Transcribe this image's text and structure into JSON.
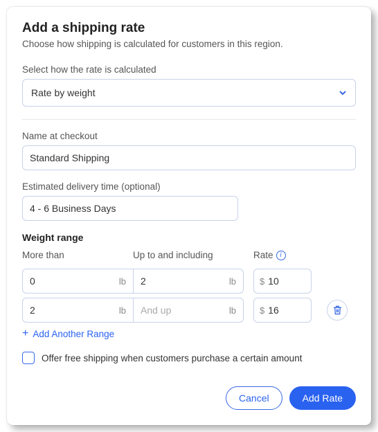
{
  "header": {
    "title": "Add a shipping rate",
    "subtitle": "Choose how shipping is calculated for customers in this region."
  },
  "calc": {
    "label": "Select how the rate is calculated",
    "value": "Rate by weight"
  },
  "nameField": {
    "label": "Name at checkout",
    "value": "Standard Shipping"
  },
  "etaField": {
    "label": "Estimated delivery time (optional)",
    "value": "4 - 6 Business Days"
  },
  "range": {
    "sectionTitle": "Weight range",
    "moreThanLabel": "More than",
    "upToLabel": "Up to and including",
    "rateLabel": "Rate",
    "unit": "lb",
    "currency": "$",
    "andUpPlaceholder": "And up",
    "rows": [
      {
        "from": "0",
        "to": "2",
        "rate": "10"
      },
      {
        "from": "2",
        "to": "",
        "rate": "16"
      }
    ],
    "addLabel": "Add Another Range"
  },
  "freeShip": {
    "label": "Offer free shipping when customers purchase a certain amount"
  },
  "footer": {
    "cancel": "Cancel",
    "add": "Add Rate"
  }
}
